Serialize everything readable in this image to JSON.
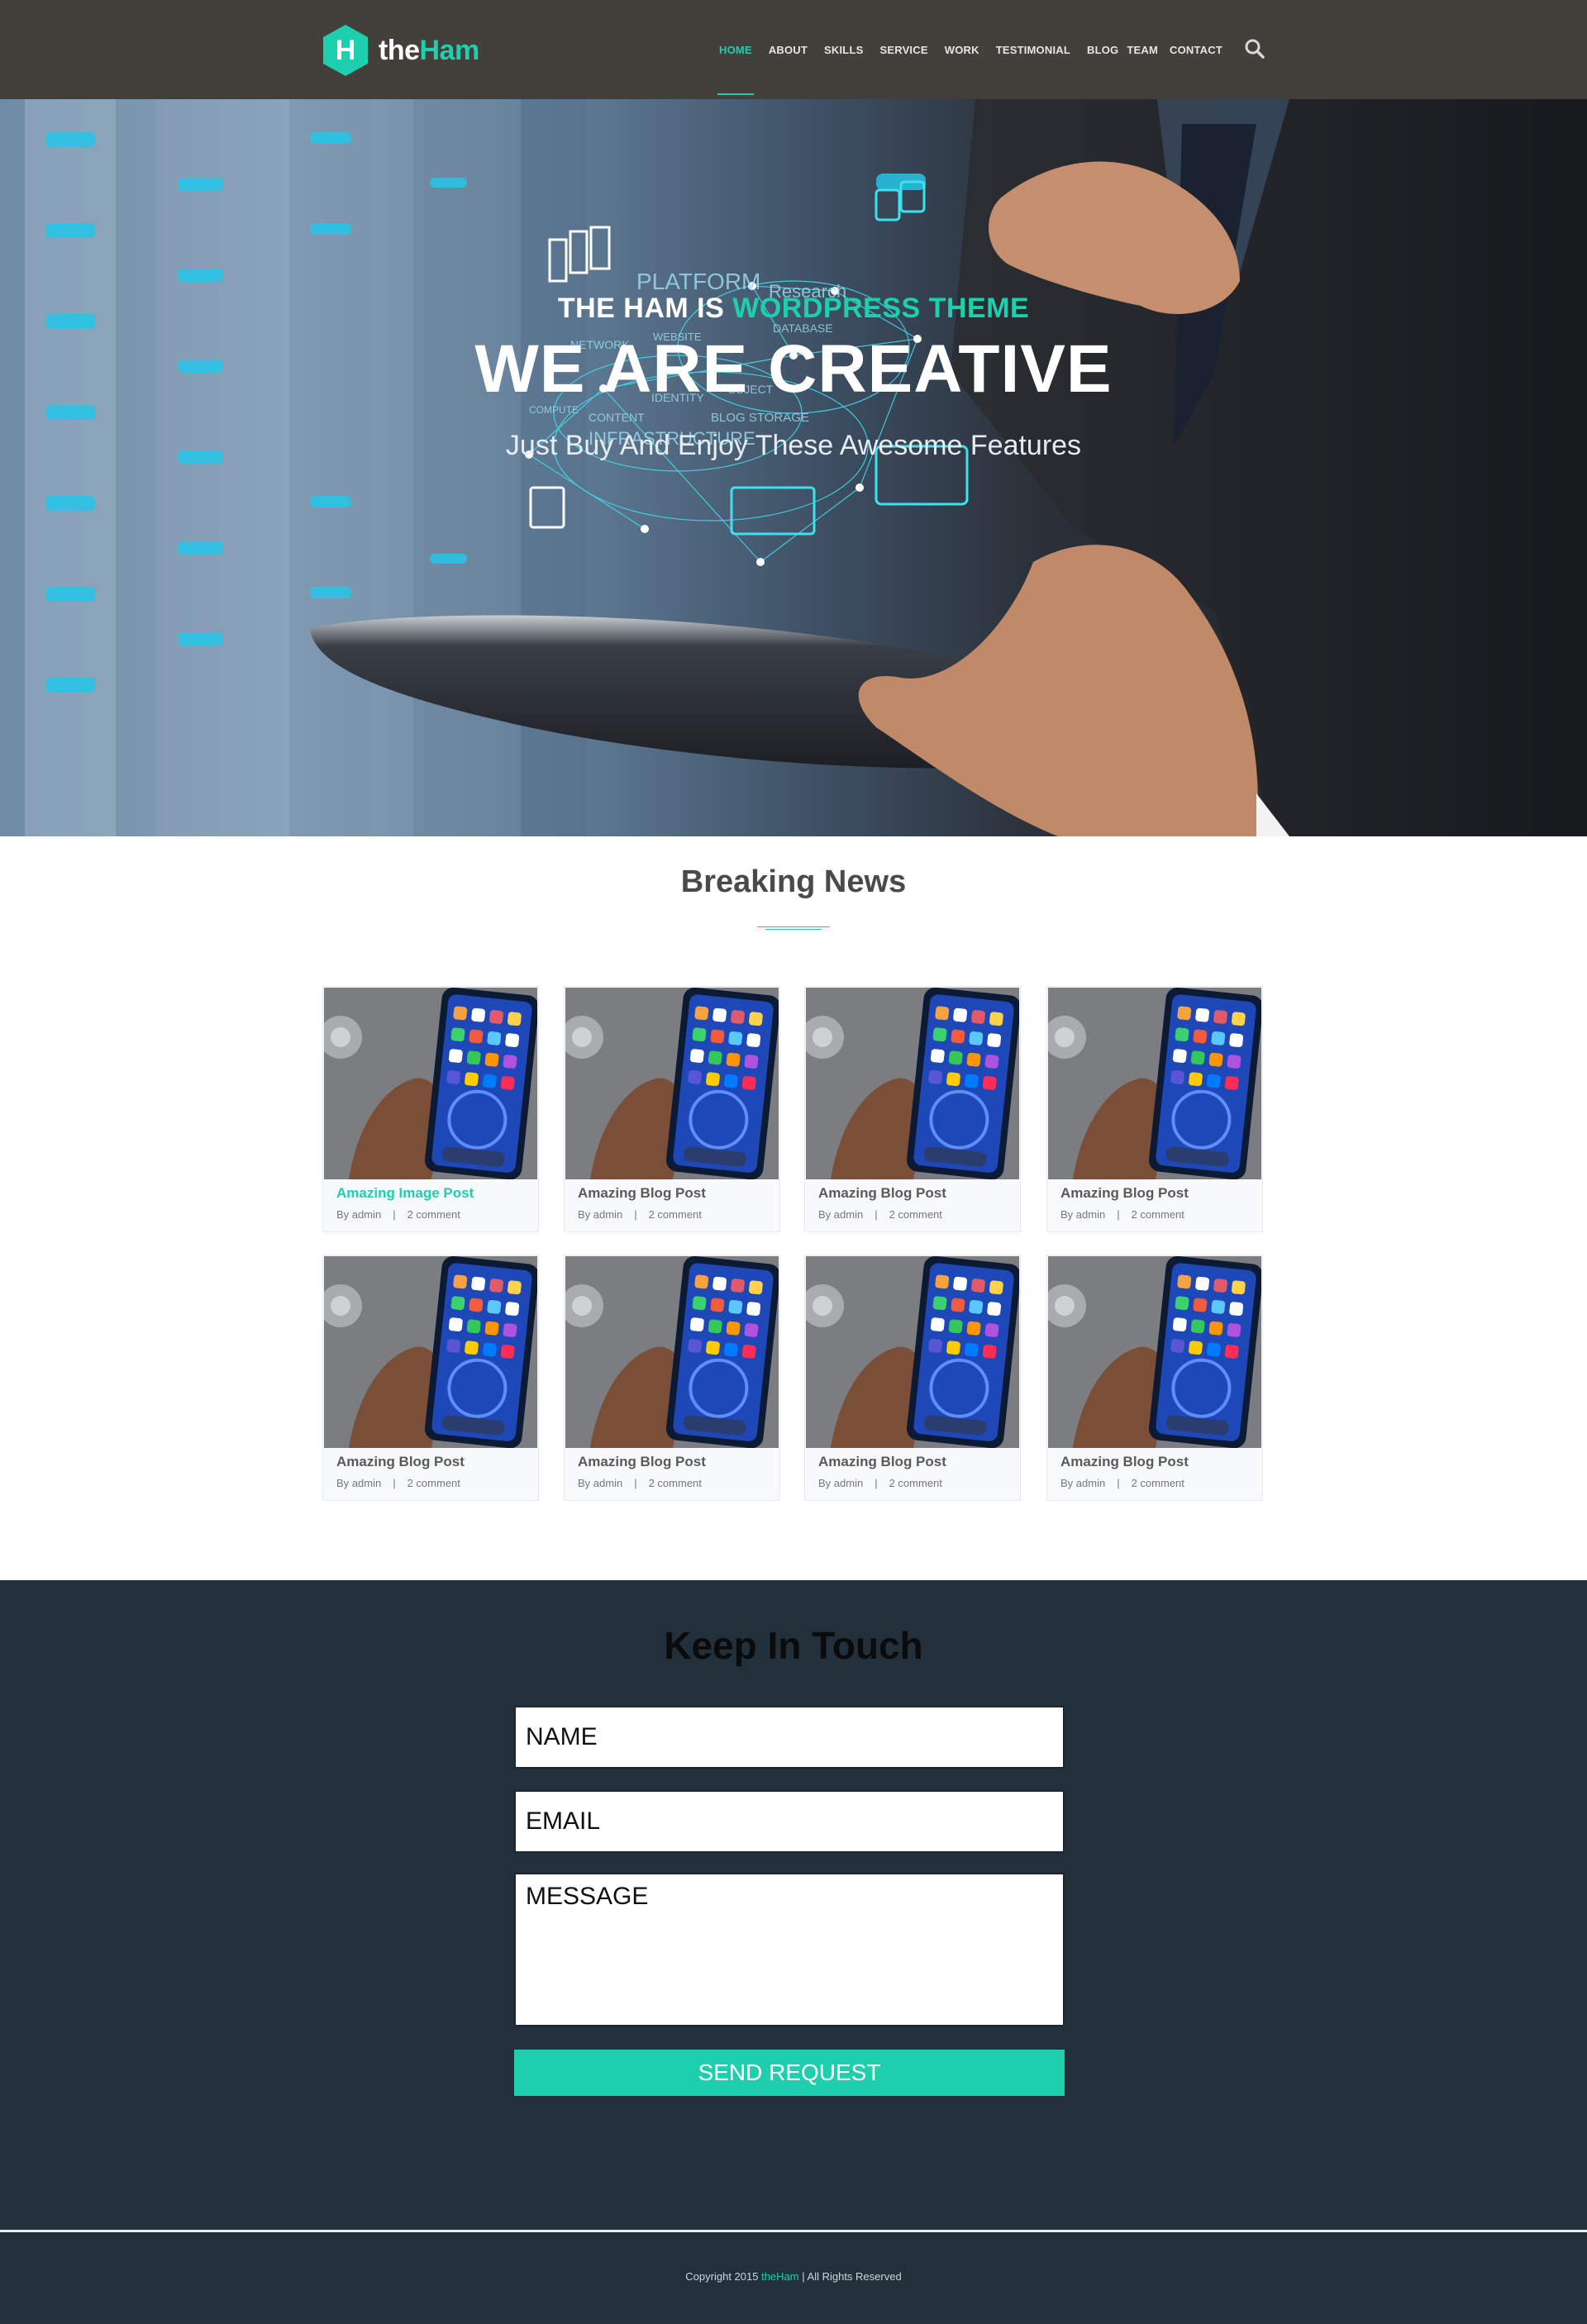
{
  "brand": {
    "prefix": "the",
    "name": "Ham",
    "logo_letter": "H",
    "accent_color": "#1ecfae"
  },
  "nav": {
    "items": [
      {
        "label": "HOME",
        "active": true
      },
      {
        "label": "ABOUT"
      },
      {
        "label": "SKILLS"
      },
      {
        "label": "SERVICE"
      },
      {
        "label": "WORK"
      },
      {
        "label": "TESTIMONIAL"
      },
      {
        "label": "BLOG"
      },
      {
        "label": "TEAM"
      },
      {
        "label": "CONTACT"
      }
    ],
    "search_icon": "search-icon"
  },
  "hero": {
    "eyebrow_white": "THE HAM IS",
    "eyebrow_accent": "WORDPRESS THEME",
    "title": "WE ARE CREATIVE",
    "subtitle": "Just Buy And Enjoy These Awesome Features",
    "graphic_words": [
      "PLATFORM",
      "Research",
      "NETWORK",
      "WEBSITE",
      "DATABASE",
      "IDENTITY",
      "OBJECT",
      "CONTENT",
      "BLOG STORAGE",
      "INFRASTRUCTURE",
      "COMPUTE"
    ]
  },
  "news": {
    "title": "Breaking News",
    "posts": [
      {
        "title": "Amazing Image Post",
        "author": "By admin",
        "separator": "|",
        "comments": "2 comment",
        "featured": true
      },
      {
        "title": "Amazing Blog Post",
        "author": "By admin",
        "separator": "|",
        "comments": "2 comment"
      },
      {
        "title": "Amazing Blog Post",
        "author": "By admin",
        "separator": "|",
        "comments": "2 comment"
      },
      {
        "title": "Amazing Blog Post",
        "author": "By admin",
        "separator": "|",
        "comments": "2 comment"
      },
      {
        "title": "Amazing Blog Post",
        "author": "By admin",
        "separator": "|",
        "comments": "2 comment"
      },
      {
        "title": "Amazing Blog Post",
        "author": "By admin",
        "separator": "|",
        "comments": "2 comment"
      },
      {
        "title": "Amazing Blog Post",
        "author": "By admin",
        "separator": "|",
        "comments": "2 comment"
      },
      {
        "title": "Amazing Blog Post",
        "author": "By admin",
        "separator": "|",
        "comments": "2 comment"
      }
    ]
  },
  "contact": {
    "title": "Keep In Touch",
    "name_placeholder": "NAME",
    "email_placeholder": "EMAIL",
    "message_placeholder": "MESSAGE",
    "submit_label": "SEND REQUEST"
  },
  "footer": {
    "prefix": "Copyright 2015",
    "brand": "theHam",
    "suffix": "| All Rights Reserved"
  }
}
